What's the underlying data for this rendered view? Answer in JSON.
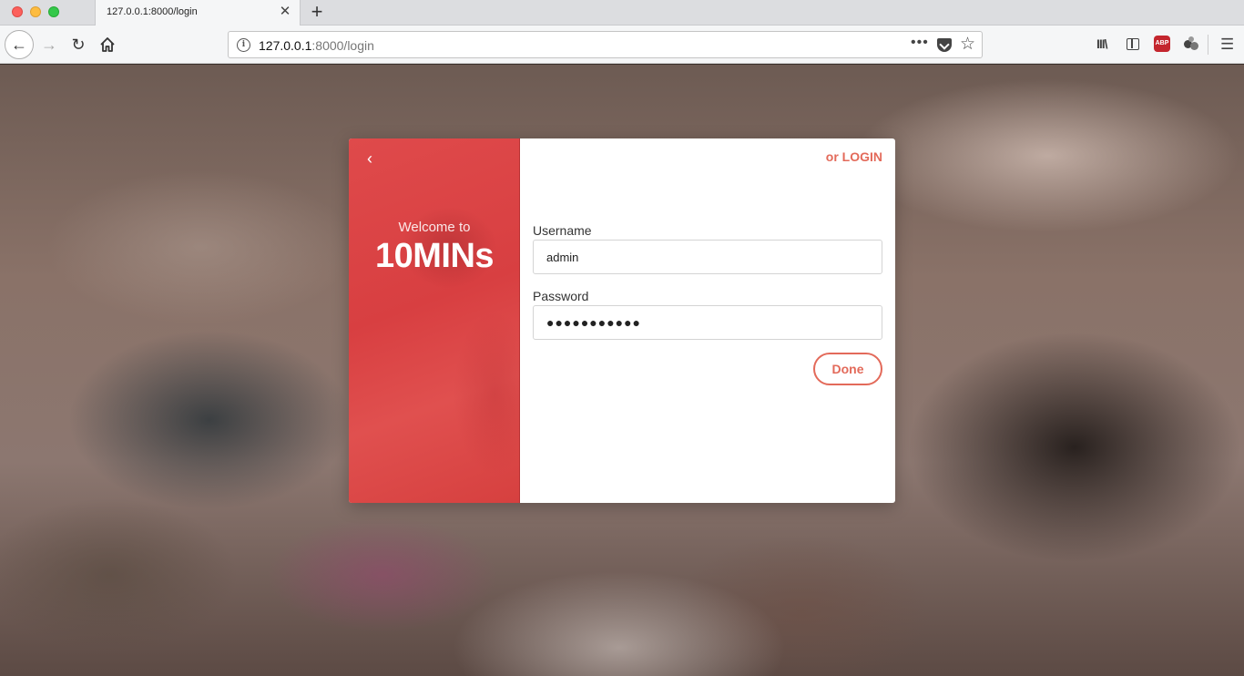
{
  "browser": {
    "tab_title": "127.0.0.1:8000/login",
    "tab_close": "✕",
    "new_tab": "+",
    "url_host": "127.0.0.1",
    "url_rest": ":8000/login",
    "url_more": "•••",
    "info_glyph": "i",
    "back_glyph": "←",
    "forward_glyph": "→",
    "reload_glyph": "↻",
    "star_glyph": "☆",
    "library_glyph": "III\\",
    "abp_label": "ABP",
    "menu_glyph": "☰",
    "icons": [
      "back-icon",
      "forward-icon",
      "reload-icon",
      "home-icon",
      "info-icon",
      "page-actions-icon",
      "pocket-icon",
      "bookmark-star-icon",
      "library-icon",
      "sidebar-icon",
      "adblock-icon",
      "extension-icon",
      "menu-icon"
    ]
  },
  "login": {
    "back_glyph": "‹",
    "welcome_sub": "Welcome to",
    "welcome_title": "10MINs",
    "switch_link": "or LOGIN",
    "username_label": "Username",
    "username_value": "admin",
    "password_label": "Password",
    "password_value": "●●●●●●●●●●●",
    "done_label": "Done"
  },
  "colors": {
    "accent": "#e36a5a",
    "panel_red": "#d83f41"
  }
}
